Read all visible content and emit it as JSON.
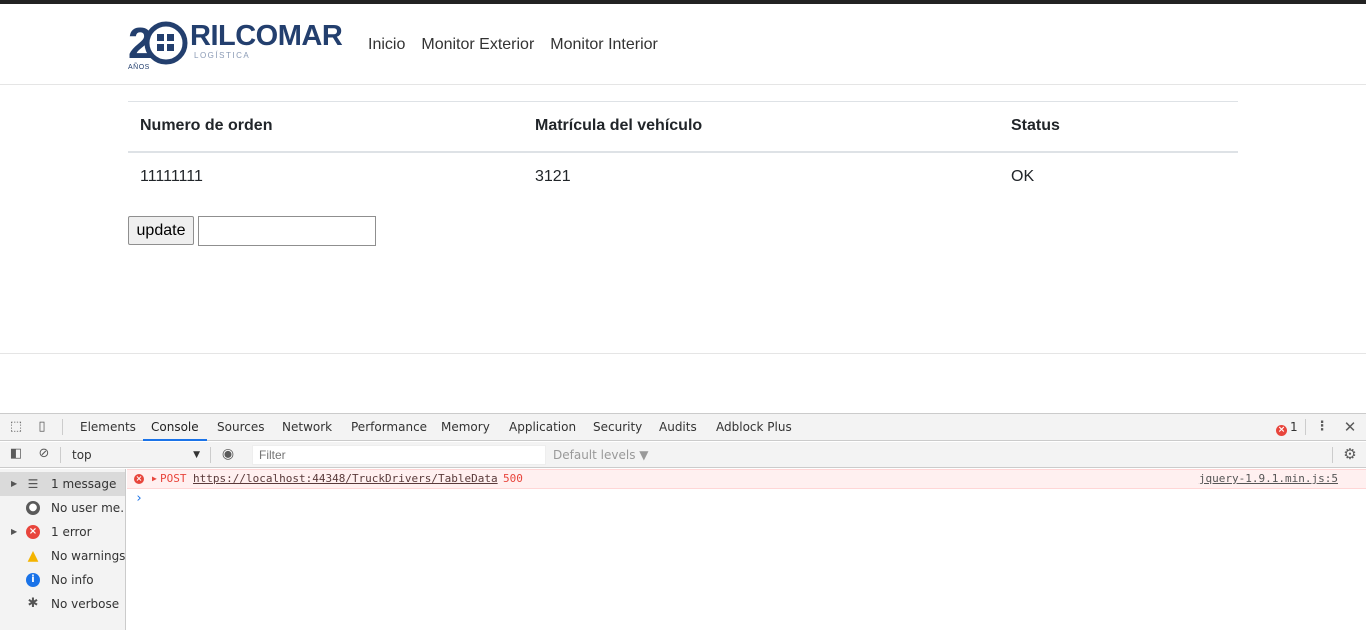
{
  "site": {
    "logo": {
      "name": "RILCOMAR",
      "sub": "LOGÍSTICA",
      "number": "20",
      "years": "AÑOS"
    },
    "nav": [
      "Inicio",
      "Monitor Exterior",
      "Monitor Interior"
    ],
    "table": {
      "headers": [
        "Numero de orden",
        "Matrícula del vehículo",
        "Status"
      ],
      "rows": [
        [
          "11111111",
          "3121",
          "OK"
        ]
      ]
    },
    "form": {
      "button_label": "update",
      "input_value": ""
    }
  },
  "devtools": {
    "tabs": [
      "Elements",
      "Console",
      "Sources",
      "Network",
      "Performance",
      "Memory",
      "Application",
      "Security",
      "Audits",
      "Adblock Plus"
    ],
    "active_tab": "Console",
    "error_count": "1",
    "context": "top",
    "filter_placeholder": "Filter",
    "levels_label": "Default levels ▼",
    "sidebar": [
      {
        "label": "1 message",
        "icon": "list-icon"
      },
      {
        "label": "No user me...",
        "icon": "user-icon"
      },
      {
        "label": "1 error",
        "icon": "error-icon"
      },
      {
        "label": "No warnings",
        "icon": "warning-icon"
      },
      {
        "label": "No info",
        "icon": "info-icon"
      },
      {
        "label": "No verbose",
        "icon": "bug-icon"
      }
    ],
    "message": {
      "method": "POST",
      "url": "https://localhost:44348/TruckDrivers/TableData",
      "status": "500",
      "source": "jquery-1.9.1.min.js:5"
    },
    "colors": {
      "error": "#e8453c",
      "accent": "#1a73e8",
      "brand": "#233f6e"
    }
  }
}
